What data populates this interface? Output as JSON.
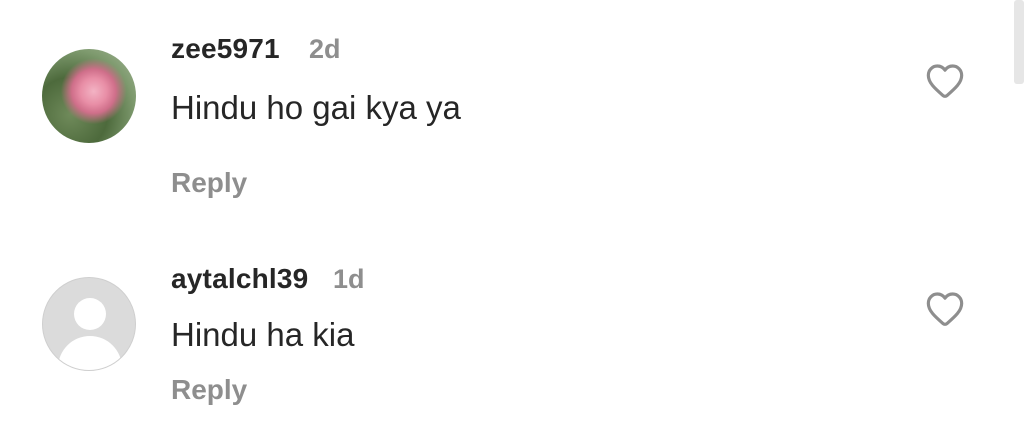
{
  "comments": [
    {
      "username": "zee5971",
      "time": "2d",
      "text": "Hindu ho gai kya ya",
      "reply_label": "Reply",
      "avatar_icon": "rose-photo-avatar",
      "like_icon": "heart-outline-icon"
    },
    {
      "username": "aytalchl39",
      "time": "1d",
      "text": "Hindu ha kia",
      "reply_label": "Reply",
      "avatar_icon": "default-user-avatar",
      "like_icon": "heart-outline-icon"
    }
  ],
  "colors": {
    "primary_text": "#262626",
    "secondary_text": "#8e8e8e",
    "background": "#ffffff",
    "default_avatar": "#dbdbdb"
  }
}
